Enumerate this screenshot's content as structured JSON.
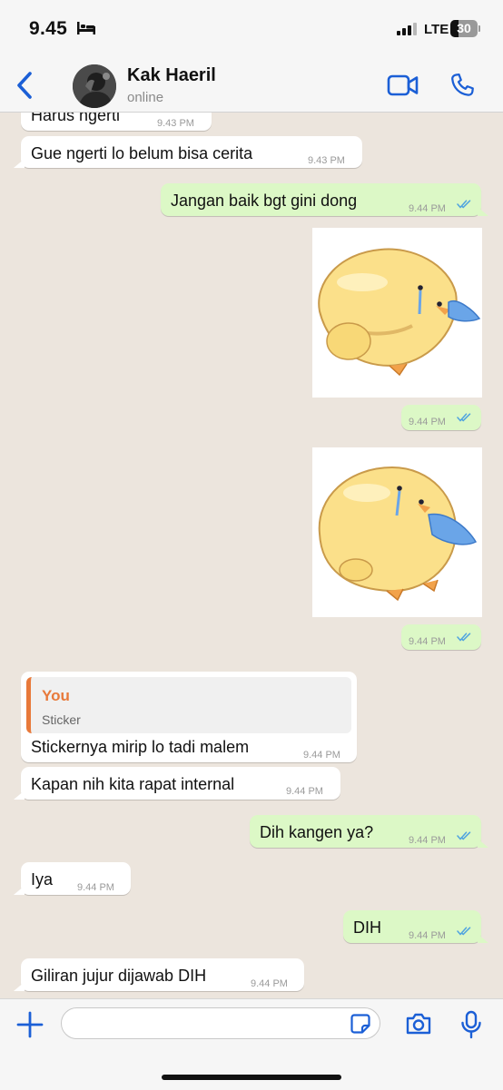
{
  "status_bar": {
    "time": "9.45",
    "network": "LTE",
    "battery": "30"
  },
  "header": {
    "contact_name": "Kak Haeril",
    "contact_status": "online"
  },
  "messages": [
    {
      "text": "Harus ngerti",
      "time": "9.43 PM"
    },
    {
      "text": "Gue ngerti lo belum bisa cerita",
      "time": "9.43 PM"
    },
    {
      "text": "Jangan baik bgt gini dong",
      "time": "9.44 PM"
    },
    {
      "type": "sticker",
      "time": "9.44 PM"
    },
    {
      "type": "sticker",
      "time": "9.44 PM"
    },
    {
      "quote_author": "You",
      "quote_text": "Sticker",
      "text": "Stickernya mirip lo tadi malem",
      "time": "9.44 PM"
    },
    {
      "text": "Kapan nih kita rapat internal",
      "time": "9.44 PM"
    },
    {
      "text": "Dih kangen ya?",
      "time": "9.44 PM"
    },
    {
      "text": "Iya",
      "time": "9.44 PM"
    },
    {
      "text": "DIH",
      "time": "9.44 PM"
    },
    {
      "text": "Giliran jujur dijawab DIH",
      "time": "9.44 PM"
    }
  ],
  "input": {
    "value": "",
    "placeholder": ""
  },
  "colors": {
    "accent": "#1b5fd6",
    "outgoing_bubble": "#dcf8c6",
    "incoming_bubble": "#ffffff",
    "chat_background": "#ece5dd",
    "quote_author": "#e8793a",
    "read_ticks": "#4fa3e0"
  },
  "icons": [
    "back-chevron-icon",
    "video-call-icon",
    "phone-icon",
    "plus-icon",
    "sticker-icon",
    "camera-icon",
    "microphone-icon",
    "double-check-icon",
    "bed-icon"
  ]
}
